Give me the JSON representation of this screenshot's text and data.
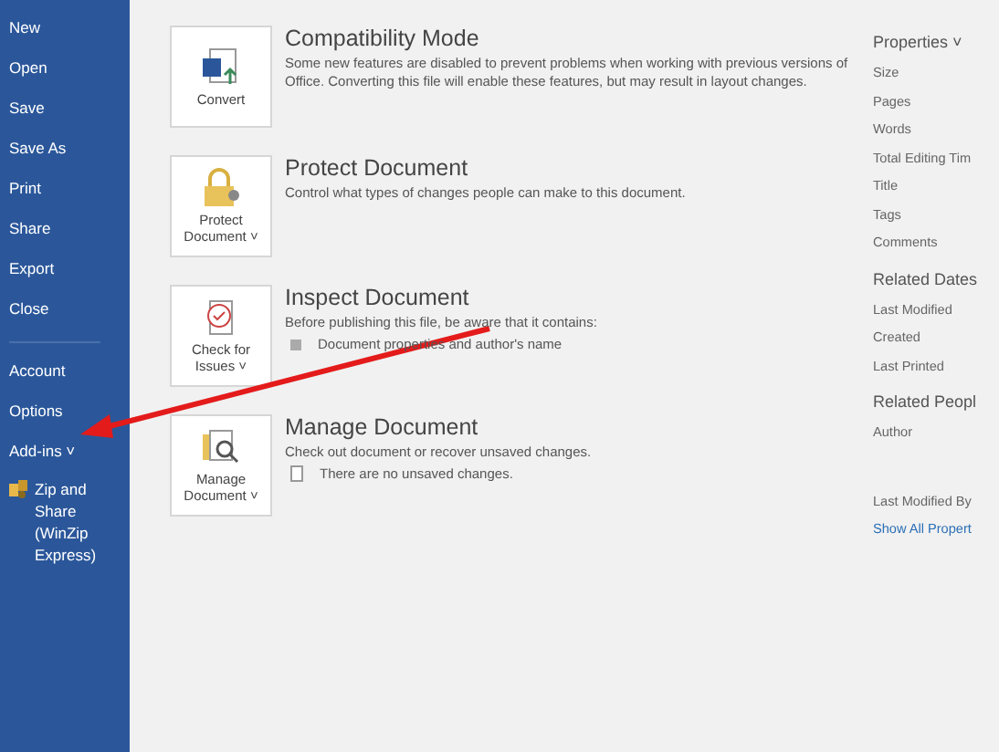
{
  "sidebar": {
    "items": [
      {
        "label": "New",
        "disabled": false
      },
      {
        "label": "Open",
        "disabled": false
      },
      {
        "label": "Save",
        "disabled": false
      },
      {
        "label": "Save As",
        "disabled": false
      },
      {
        "label": "Print",
        "disabled": false
      },
      {
        "label": "Share",
        "disabled": false
      },
      {
        "label": "Export",
        "disabled": false
      },
      {
        "label": "Close",
        "disabled": false
      },
      {
        "kind": "divider"
      },
      {
        "label": "Account",
        "disabled": false
      },
      {
        "label": "Options",
        "disabled": false
      },
      {
        "label": "Add-ins ˅",
        "disabled": false
      },
      {
        "label": "Zip and Share (WinZip Express)",
        "disabled": false,
        "kind": "addin"
      }
    ]
  },
  "sections": [
    {
      "kind": "convert",
      "button": "Convert",
      "title": "Compatibility Mode",
      "description": "Some new features are disabled to prevent problems when working with previous versions of Office. Converting this file will enable these features, but may result in layout changes."
    },
    {
      "kind": "protect",
      "button": "Protect Document ˅",
      "title": "Protect Document",
      "description": "Control what types of changes people can make to this document."
    },
    {
      "kind": "inspect",
      "button": "Check for Issues ˅",
      "title": "Inspect Document",
      "description": "Before publishing this file, be aware that it contains:",
      "bullet": "Document properties and author's name"
    },
    {
      "kind": "manage",
      "button": "Manage Document ˅",
      "title": "Manage Document",
      "description": "Check out document or recover unsaved changes.",
      "bullet": "There are no unsaved changes."
    }
  ],
  "properties": {
    "heading": "Properties ˅",
    "items": [
      "Size",
      "Pages",
      "Words",
      "Total Editing Tim",
      "Title",
      "Tags",
      "Comments"
    ]
  },
  "related_dates": {
    "heading": "Related Dates",
    "items": [
      "Last Modified",
      "Created",
      "Last Printed"
    ]
  },
  "related_people": {
    "heading": "Related Peopl",
    "items": [
      "Author"
    ]
  },
  "last_modified_by": "Last Modified By",
  "show_all_link": "Show All Propert"
}
